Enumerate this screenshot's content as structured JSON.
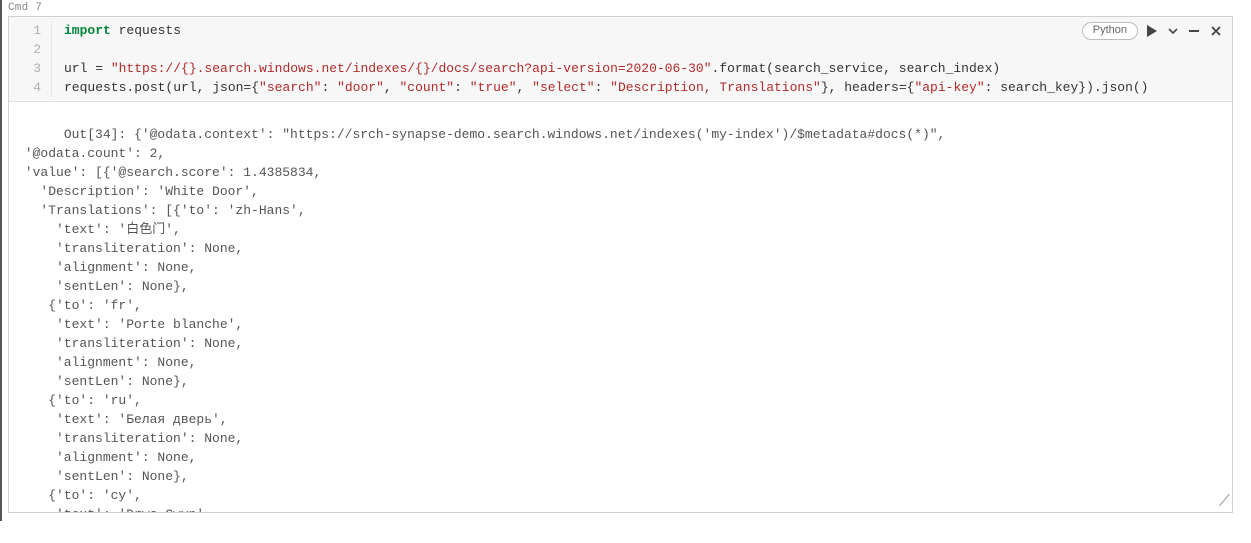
{
  "cmd_label": "Cmd 7",
  "lang": "Python",
  "toolbar_icons": {
    "run": "run-icon",
    "run_menu": "chevron-down-icon",
    "minimize": "minimize-icon",
    "close": "close-icon"
  },
  "code": {
    "lines": [
      {
        "n": "1",
        "tokens": [
          {
            "cls": "kw",
            "t": "import"
          },
          {
            "cls": "name",
            "t": " requests"
          }
        ]
      },
      {
        "n": "2",
        "tokens": []
      },
      {
        "n": "3",
        "tokens": [
          {
            "cls": "name",
            "t": "url = "
          },
          {
            "cls": "str",
            "t": "\"https://{}.search.windows.net/indexes/{}/docs/search?api-version=2020-06-30\""
          },
          {
            "cls": "punc",
            "t": "."
          },
          {
            "cls": "func",
            "t": "format"
          },
          {
            "cls": "punc",
            "t": "("
          },
          {
            "cls": "name",
            "t": "search_service, search_index"
          },
          {
            "cls": "punc",
            "t": ")"
          }
        ]
      },
      {
        "n": "4",
        "tokens": [
          {
            "cls": "name",
            "t": "requests.post(url, json={"
          },
          {
            "cls": "str",
            "t": "\"search\""
          },
          {
            "cls": "punc",
            "t": ": "
          },
          {
            "cls": "str",
            "t": "\"door\""
          },
          {
            "cls": "punc",
            "t": ", "
          },
          {
            "cls": "str",
            "t": "\"count\""
          },
          {
            "cls": "punc",
            "t": ": "
          },
          {
            "cls": "str",
            "t": "\"true\""
          },
          {
            "cls": "punc",
            "t": ", "
          },
          {
            "cls": "str",
            "t": "\"select\""
          },
          {
            "cls": "punc",
            "t": ": "
          },
          {
            "cls": "str",
            "t": "\"Description, Translations\""
          },
          {
            "cls": "punc",
            "t": "}, headers={"
          },
          {
            "cls": "str",
            "t": "\"api-key\""
          },
          {
            "cls": "punc",
            "t": ": search_key}).json()"
          }
        ]
      }
    ]
  },
  "output_text": "Out[34]: {'@odata.context': \"https://srch-synapse-demo.search.windows.net/indexes('my-index')/$metadata#docs(*)\",\n '@odata.count': 2,\n 'value': [{'@search.score': 1.4385834,\n   'Description': 'White Door',\n   'Translations': [{'to': 'zh-Hans',\n     'text': '白色门',\n     'transliteration': None,\n     'alignment': None,\n     'sentLen': None},\n    {'to': 'fr',\n     'text': 'Porte blanche',\n     'transliteration': None,\n     'alignment': None,\n     'sentLen': None},\n    {'to': 'ru',\n     'text': 'Белая дверь',\n     'transliteration': None,\n     'alignment': None,\n     'sentLen': None},\n    {'to': 'cy',\n     'text': 'Drws Gwvn'."
}
